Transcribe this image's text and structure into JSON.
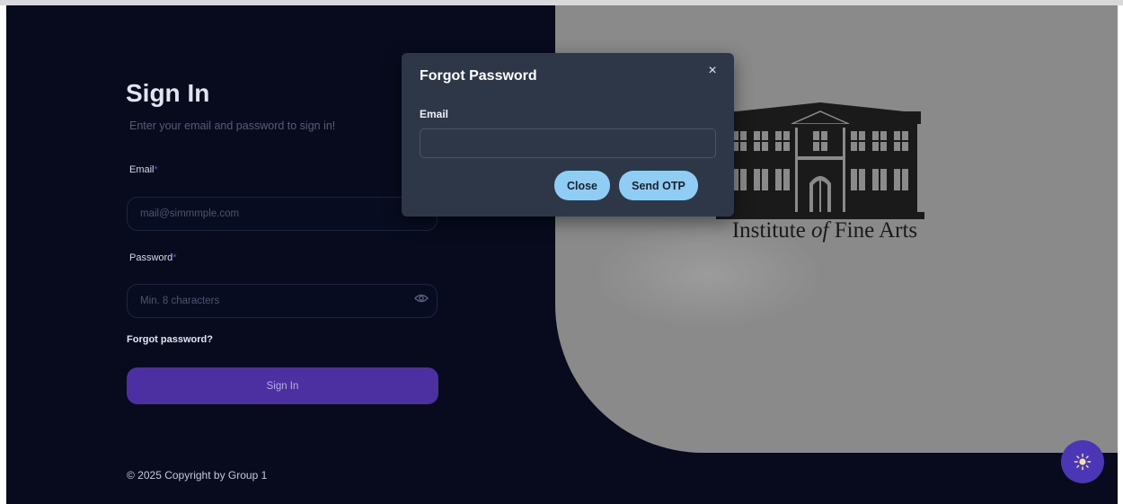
{
  "signin": {
    "title": "Sign In",
    "subtitle": "Enter your email and password to sign in!",
    "email_label": "Email",
    "email_placeholder": "mail@simmmple.com",
    "password_label": "Password",
    "password_placeholder": "Min. 8 characters",
    "required_mark": "*",
    "forgot_link": "Forgot password?",
    "submit_label": "Sign In"
  },
  "footer": {
    "copyright": "© 2025 Copyright by Group 1"
  },
  "brand": {
    "name_before": "Institute ",
    "name_italic": "of",
    "name_after": " Fine Arts"
  },
  "modal": {
    "title": "Forgot Password",
    "close_x": "×",
    "email_label": "Email",
    "email_value": "",
    "close_label": "Close",
    "send_label": "Send OTP"
  },
  "icons": {
    "password_toggle": "eye-icon",
    "theme_toggle": "sun-icon",
    "modal_close": "close-icon"
  },
  "colors": {
    "background": "#070b1d",
    "accent": "#4c2fa0",
    "modal_bg": "#2d3748",
    "modal_button": "#90cdf4",
    "art_panel": "#8a8a8a"
  }
}
